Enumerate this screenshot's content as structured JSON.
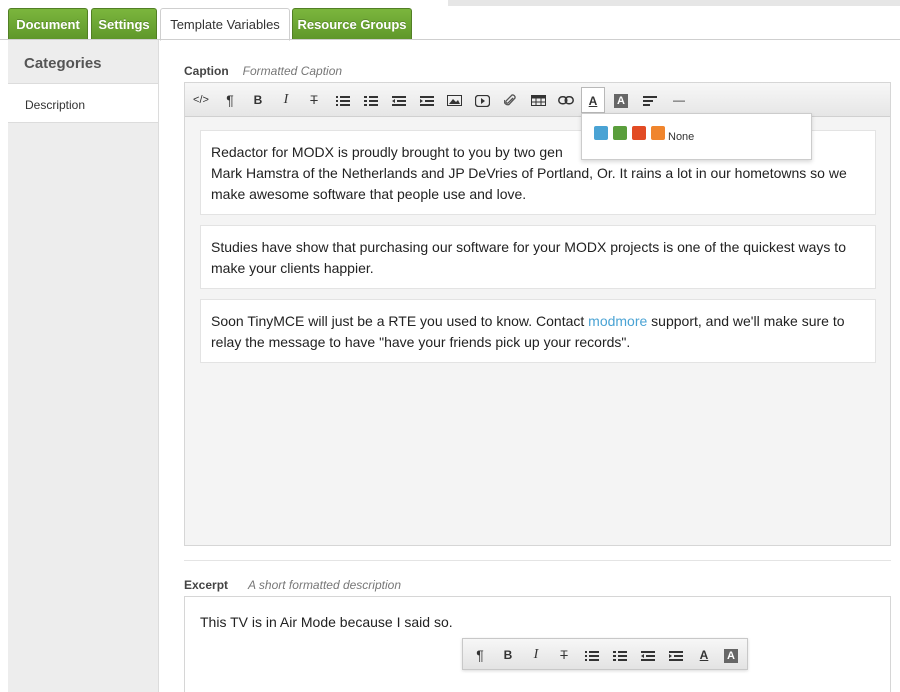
{
  "tabs": [
    {
      "label": "Document"
    },
    {
      "label": "Settings"
    },
    {
      "label": "Template Variables"
    },
    {
      "label": "Resource Groups"
    }
  ],
  "sidebar": {
    "heading": "Categories",
    "items": [
      {
        "label": "Description"
      }
    ]
  },
  "caption": {
    "label": "Caption",
    "description": "Formatted Caption",
    "toolbar": [
      "code-icon",
      "paragraph-icon",
      "bold-icon",
      "italic-icon",
      "strikethrough-icon",
      "unordered-list-icon",
      "ordered-list-icon",
      "outdent-icon",
      "indent-icon",
      "image-icon",
      "video-icon",
      "attachment-icon",
      "table-icon",
      "link-icon",
      "font-color-icon",
      "background-color-icon",
      "align-icon",
      "horizontal-rule-icon"
    ],
    "paragraphs": [
      {
        "text": "Redactor for MODX is proudly brought to you by two gen"
      },
      {
        "text": "Studies have show that purchasing our software for your MODX projects is one of the quickest ways to make your clients happier."
      },
      {
        "before": "Soon TinyMCE will just be a RTE you used to know. Contact ",
        "link": "modmore",
        "after": " support, and we'll make sure to relay the message to have \"have your friends pick up your records\"."
      }
    ],
    "paragraph1_line2": "Mark Hamstra of the Netherlands and JP DeVries of Portland, Or. It rains a lot in our hometowns so we make awesome software that people use and love.",
    "color_dropdown": {
      "colors": [
        "#4aa3d4",
        "#5a9e3c",
        "#e24b24",
        "#f0852d"
      ],
      "none_label": "None"
    }
  },
  "excerpt": {
    "label": "Excerpt",
    "description": "A short formatted description",
    "text": "This TV is in Air Mode because I said so.",
    "air_toolbar": [
      "paragraph-icon",
      "bold-icon",
      "italic-icon",
      "strikethrough-icon",
      "unordered-list-icon",
      "ordered-list-icon",
      "outdent-icon",
      "indent-icon",
      "font-color-icon",
      "background-color-icon"
    ]
  },
  "glyphs": {
    "code": "</>",
    "paragraph": "¶",
    "bold": "B",
    "italic": "I",
    "strike": "T",
    "hr": "—",
    "font_a": "A"
  }
}
